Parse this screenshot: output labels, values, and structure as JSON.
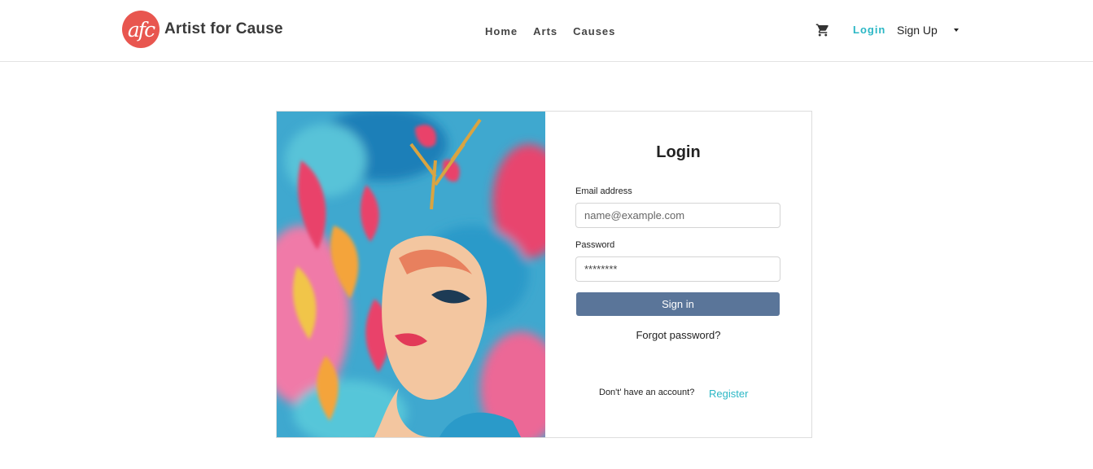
{
  "brand": {
    "logo_text": "afc",
    "name": "Artist for Cause",
    "logo_color": "#e8564f"
  },
  "nav": {
    "items": [
      {
        "label": "Home"
      },
      {
        "label": "Arts"
      },
      {
        "label": "Causes"
      }
    ]
  },
  "header_actions": {
    "cart_icon": "shopping-cart-icon",
    "login_label": "Login",
    "signup_label": "Sign Up",
    "accent_color": "#2bb7c5"
  },
  "login_form": {
    "title": "Login",
    "email_label": "Email address",
    "email_placeholder": "name@example.com",
    "email_value": "",
    "password_label": "Password",
    "password_value": "********",
    "submit_label": "Sign in",
    "submit_color": "#5a7599",
    "forgot_label": "Forgot password?",
    "no_account_text": "Don't' have an account?",
    "register_label": "Register"
  }
}
